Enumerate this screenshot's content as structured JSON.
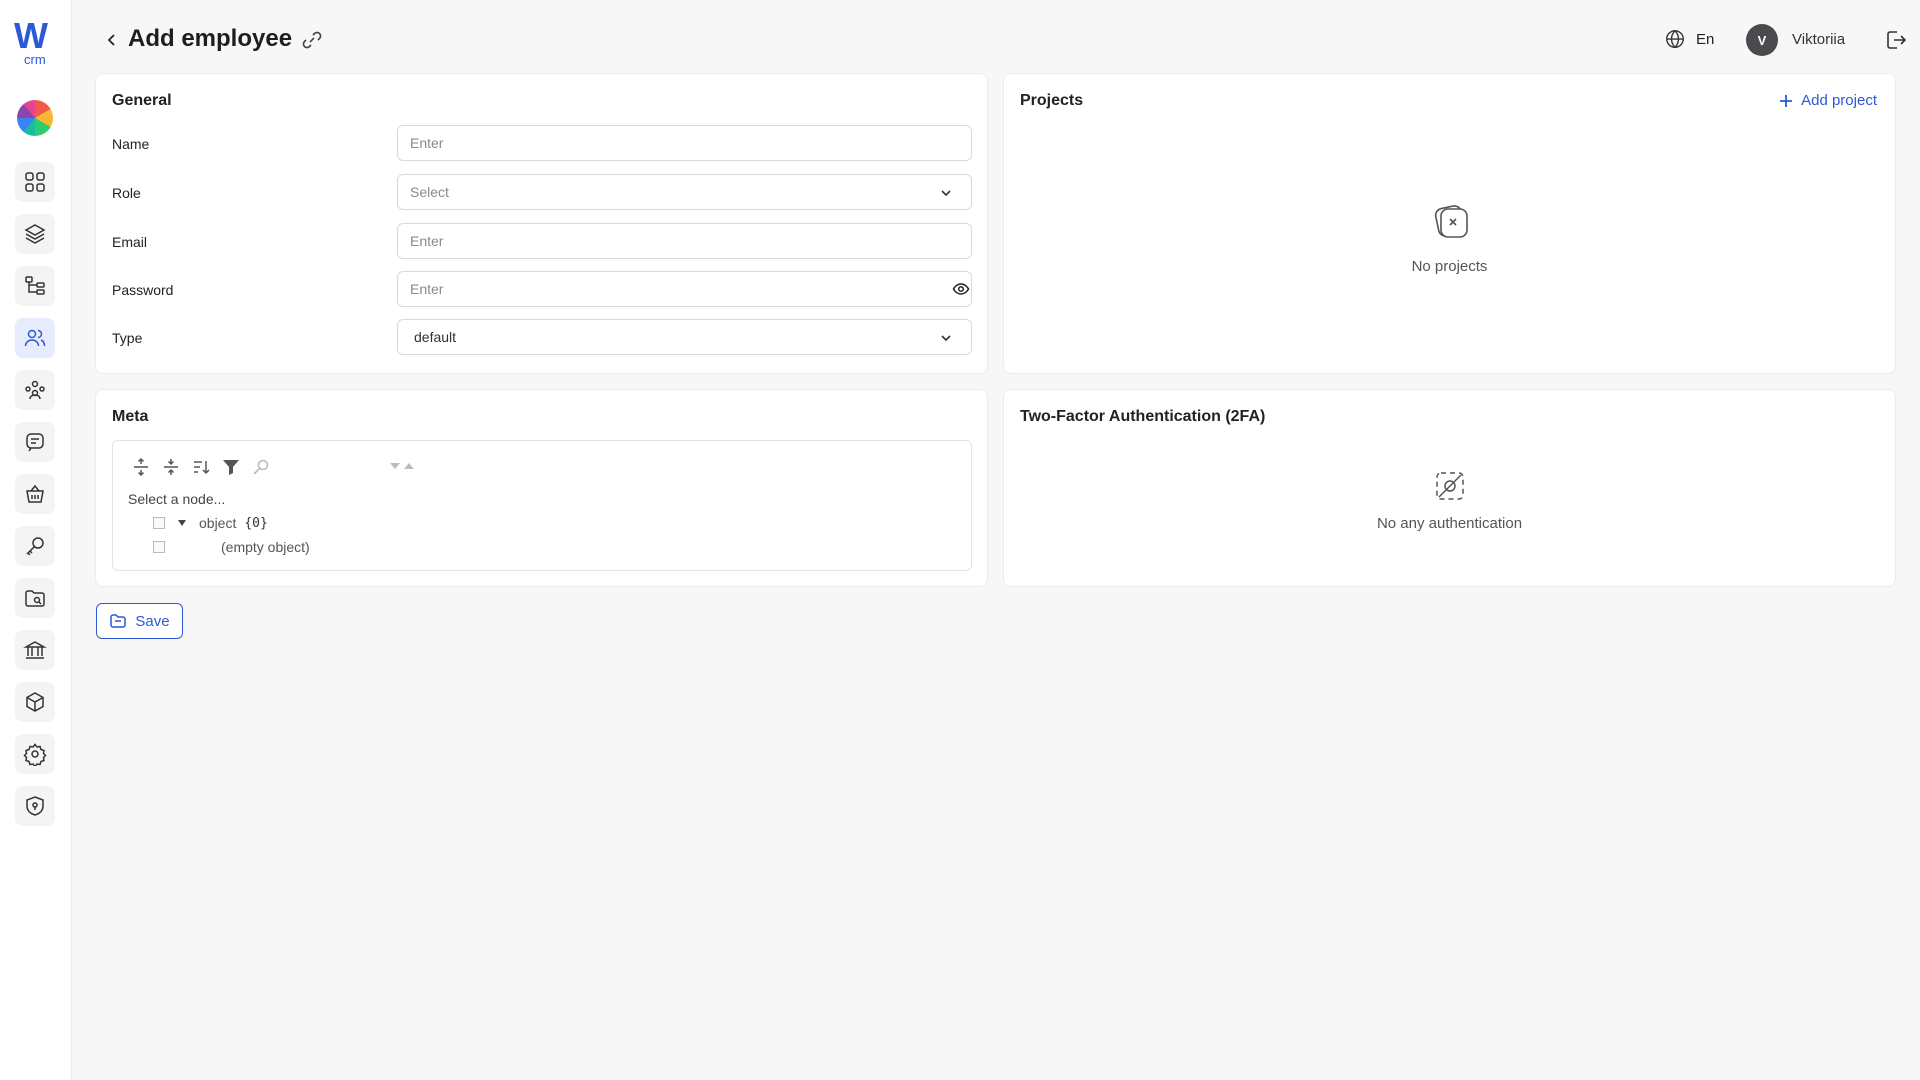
{
  "brand": {
    "logo_letter": "W",
    "logo_sub": "crm",
    "accent": "#2c59d8"
  },
  "sidebar": {
    "items": [
      {
        "icon": "dashboard-grid-icon"
      },
      {
        "icon": "layers-icon"
      },
      {
        "icon": "hierarchy-icon"
      },
      {
        "icon": "users-icon",
        "active": true
      },
      {
        "icon": "team-icon"
      },
      {
        "icon": "chat-icon"
      },
      {
        "icon": "basket-icon"
      },
      {
        "icon": "key-icon"
      },
      {
        "icon": "folder-search-icon"
      },
      {
        "icon": "bank-icon"
      },
      {
        "icon": "box-icon"
      },
      {
        "icon": "settings-icon"
      },
      {
        "icon": "shield-icon"
      }
    ]
  },
  "header": {
    "title": "Add employee",
    "language": "En",
    "user_initial": "V",
    "user_name": "Viktoriia"
  },
  "general": {
    "title": "General",
    "fields": {
      "name": {
        "label": "Name",
        "placeholder": "Enter",
        "value": ""
      },
      "role": {
        "label": "Role",
        "value": "Select"
      },
      "email": {
        "label": "Email",
        "placeholder": "Enter",
        "value": ""
      },
      "password": {
        "label": "Password",
        "placeholder": "Enter",
        "value": ""
      },
      "type": {
        "label": "Type",
        "value": "default"
      }
    }
  },
  "projects": {
    "title": "Projects",
    "add_label": "Add project",
    "empty_text": "No projects"
  },
  "meta": {
    "title": "Meta",
    "path_text": "Select a node...",
    "root_label": "object",
    "root_count": "{0}",
    "empty_label": "(empty object)"
  },
  "two_fa": {
    "title": "Two-Factor Authentication (2FA)",
    "empty_text": "No any authentication"
  },
  "actions": {
    "save_label": "Save"
  }
}
